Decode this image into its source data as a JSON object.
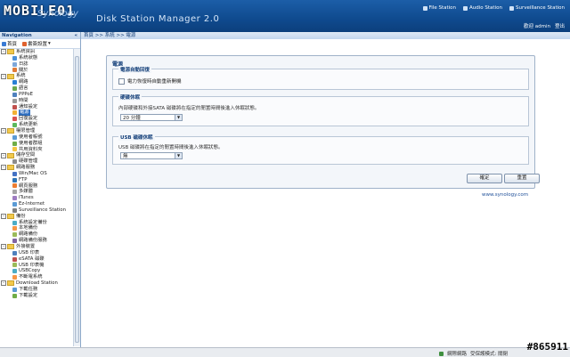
{
  "header": {
    "brand": "MOBILE01",
    "brand_sub": "Synology",
    "product": "Disk Station Manager 2.0",
    "links": [
      "File Station",
      "Audio Station",
      "Surveillance Station"
    ],
    "user_text": "歡迎 admin",
    "logout": "登出"
  },
  "sidebar": {
    "title": "Navigation",
    "collapse": "«",
    "tool_home": "首頁",
    "tool_bookmark": "書簽設置",
    "items": [
      {
        "label": "系統資訊",
        "type": "folder"
      },
      {
        "label": "系統狀態",
        "type": "leaf",
        "color": "#4a90d9"
      },
      {
        "label": "日誌",
        "type": "leaf",
        "color": "#7da7d9"
      },
      {
        "label": "關於",
        "type": "leaf",
        "color": "#e07b39"
      },
      {
        "label": "系統",
        "type": "folder"
      },
      {
        "label": "網路",
        "type": "leaf",
        "color": "#2a7fd4"
      },
      {
        "label": "語言",
        "type": "leaf",
        "color": "#6aa84f"
      },
      {
        "label": "PPPoE",
        "type": "leaf",
        "color": "#4f81bd"
      },
      {
        "label": "時間",
        "type": "leaf",
        "color": "#999999"
      },
      {
        "label": "通知設定",
        "type": "leaf",
        "color": "#c0504d"
      },
      {
        "label": "電源",
        "type": "leaf",
        "color": "#f2b134",
        "selected": true
      },
      {
        "label": "回復設定",
        "type": "leaf",
        "color": "#d9534f"
      },
      {
        "label": "系統更新",
        "type": "leaf",
        "color": "#5cb85c"
      },
      {
        "label": "權限管理",
        "type": "folder"
      },
      {
        "label": "使用者帳號",
        "type": "leaf",
        "color": "#5b9bd5"
      },
      {
        "label": "使用者群組",
        "type": "leaf",
        "color": "#70ad47"
      },
      {
        "label": "共用資料夾",
        "type": "leaf",
        "color": "#f4c542"
      },
      {
        "label": "儲存空間",
        "type": "folder"
      },
      {
        "label": "硬碟管理",
        "type": "leaf",
        "color": "#8c8c8c"
      },
      {
        "label": "網路服務",
        "type": "folder"
      },
      {
        "label": "Win/Mac OS",
        "type": "leaf",
        "color": "#4472c4"
      },
      {
        "label": "FTP",
        "type": "leaf",
        "color": "#2e75b6"
      },
      {
        "label": "網頁服務",
        "type": "leaf",
        "color": "#ed7d31"
      },
      {
        "label": "多媒體",
        "type": "leaf",
        "color": "#a5a5a5"
      },
      {
        "label": "iTunes",
        "type": "leaf",
        "color": "#9e7cc1"
      },
      {
        "label": "Ez-Internet",
        "type": "leaf",
        "color": "#5b9bd5"
      },
      {
        "label": "Surveillance Station",
        "type": "leaf",
        "color": "#7f7f7f"
      },
      {
        "label": "備份",
        "type": "folder"
      },
      {
        "label": "系統設定備份",
        "type": "leaf",
        "color": "#4bacc6"
      },
      {
        "label": "本地備份",
        "type": "leaf",
        "color": "#f79646"
      },
      {
        "label": "網路備份",
        "type": "leaf",
        "color": "#9bbb59"
      },
      {
        "label": "網路備份服務",
        "type": "leaf",
        "color": "#8064a2"
      },
      {
        "label": "外接裝置",
        "type": "folder"
      },
      {
        "label": "USB 印表",
        "type": "leaf",
        "color": "#4f81bd"
      },
      {
        "label": "eSATA 磁碟",
        "type": "leaf",
        "color": "#c0504d"
      },
      {
        "label": "USB 印表機",
        "type": "leaf",
        "color": "#9bbb59"
      },
      {
        "label": "USBCopy",
        "type": "leaf",
        "color": "#4bacc6"
      },
      {
        "label": "不斷電系統",
        "type": "leaf",
        "color": "#f79646"
      },
      {
        "label": "Download Station",
        "type": "folder"
      },
      {
        "label": "下載任務",
        "type": "leaf",
        "color": "#5b9bd5"
      },
      {
        "label": "下載設定",
        "type": "leaf",
        "color": "#70ad47"
      }
    ]
  },
  "breadcrumb": "首頁 >> 系統 >> 電源",
  "panel": {
    "title": "電源",
    "group1": {
      "legend": "電源自動回復",
      "checkbox": "電力恢復時自動重新開機"
    },
    "group2": {
      "legend": "硬碟休眠",
      "desc": "內部硬碟和外接SATA 磁碟將在指定的閒置時間後進入休眠狀態。",
      "value": "20 分鐘"
    },
    "group3": {
      "legend": "USB 磁碟休眠",
      "desc": "USB 磁碟將在指定的閒置時間後進入休眠狀態。",
      "value": "無"
    },
    "ok": "確定",
    "reset": "重置",
    "link": "www.synology.com"
  },
  "statusbar": {
    "zone": "網際網路",
    "mode": "受保護模式: 關閉",
    "zoom": ""
  },
  "watermark": "#865911"
}
